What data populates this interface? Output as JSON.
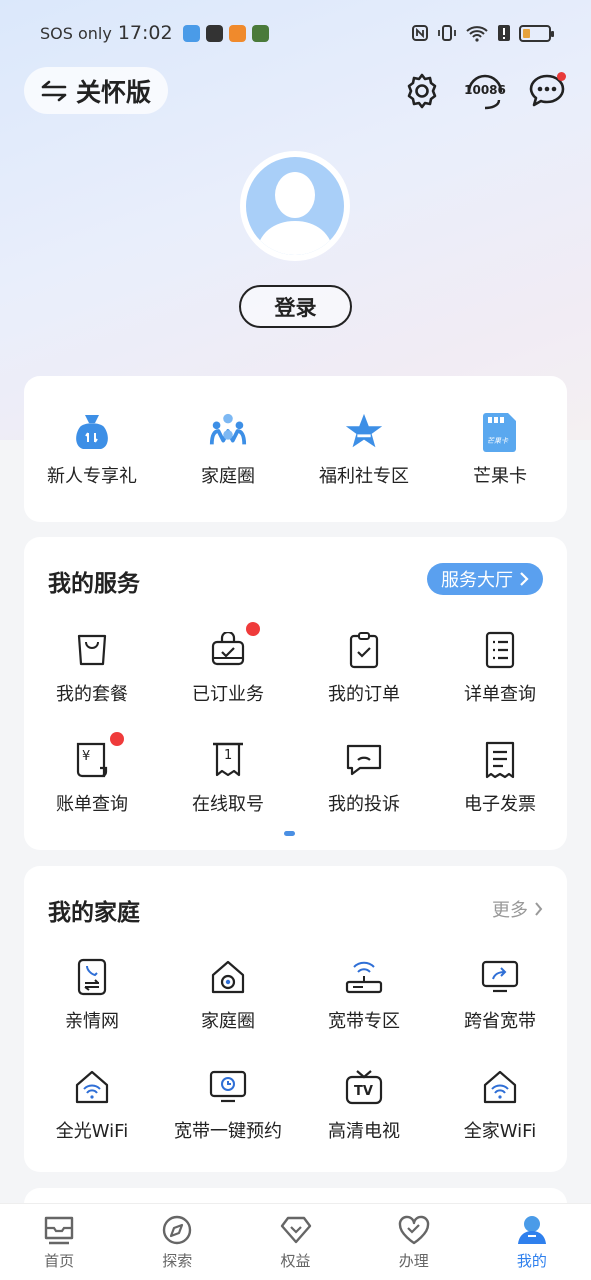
{
  "status_bar": {
    "carrier": "SOS only",
    "time": "17:02"
  },
  "header": {
    "care_mode_label": "关怀版",
    "hotline_label": "10086"
  },
  "profile": {
    "login_label": "登录"
  },
  "quick_entries": [
    {
      "label": "新人专享礼",
      "icon": "gift-bag-icon"
    },
    {
      "label": "家庭圈",
      "icon": "family-icon"
    },
    {
      "label": "福利社专区",
      "icon": "star-icon"
    },
    {
      "label": "芒果卡",
      "icon": "sim-card-icon",
      "badge": "芒果卡"
    }
  ],
  "my_services": {
    "title": "我的服务",
    "hall_button": "服务大厅",
    "items": [
      {
        "label": "我的套餐",
        "icon": "bag-icon"
      },
      {
        "label": "已订业务",
        "icon": "subscribed-icon",
        "has_dot": true
      },
      {
        "label": "我的订单",
        "icon": "clipboard-check-icon"
      },
      {
        "label": "详单查询",
        "icon": "list-doc-icon"
      },
      {
        "label": "账单查询",
        "icon": "bill-yen-icon",
        "has_dot": true,
        "yen": "¥"
      },
      {
        "label": "在线取号",
        "icon": "ticket-icon",
        "number": "1"
      },
      {
        "label": "我的投诉",
        "icon": "complaint-icon"
      },
      {
        "label": "电子发票",
        "icon": "invoice-icon"
      }
    ]
  },
  "my_family": {
    "title": "我的家庭",
    "more_label": "更多",
    "items": [
      {
        "label": "亲情网",
        "icon": "phone-transfer-icon"
      },
      {
        "label": "家庭圈",
        "icon": "home-camera-icon"
      },
      {
        "label": "宽带专区",
        "icon": "router-icon"
      },
      {
        "label": "跨省宽带",
        "icon": "monitor-share-icon"
      },
      {
        "label": "全光WiFi",
        "icon": "home-wifi-icon"
      },
      {
        "label": "宽带一键预约",
        "icon": "monitor-clock-icon"
      },
      {
        "label": "高清电视",
        "icon": "tv-icon",
        "tv": "TV"
      },
      {
        "label": "全家WiFi",
        "icon": "home-wifi-icon-2"
      }
    ]
  },
  "tabbar": {
    "active": 4,
    "tabs": [
      {
        "label": "首页",
        "icon": "home-icon"
      },
      {
        "label": "探索",
        "icon": "compass-icon"
      },
      {
        "label": "权益",
        "icon": "diamond-icon"
      },
      {
        "label": "办理",
        "icon": "heart-icon"
      },
      {
        "label": "我的",
        "icon": "user-icon"
      }
    ]
  },
  "colors": {
    "accent": "#2f80ed",
    "hall_button": "#5aa0ef",
    "dot": "#ef3b3b",
    "icon_blue": "#3d8fe6"
  }
}
